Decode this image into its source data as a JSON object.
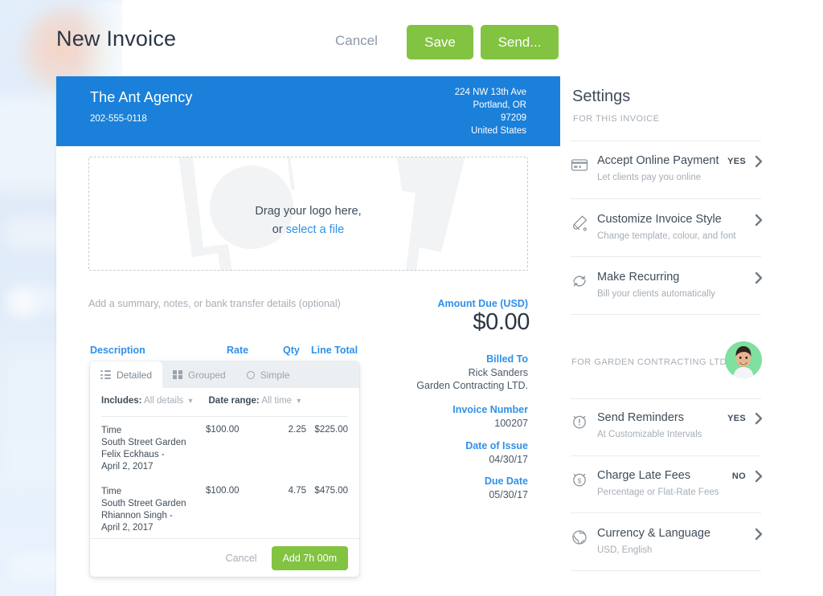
{
  "header": {
    "title": "New Invoice",
    "cancel_label": "Cancel",
    "save_label": "Save",
    "send_label": "Send...",
    "accent_green": "#82c341"
  },
  "invoice": {
    "accent_blue": "#1b80d9",
    "company_name": "The Ant Agency",
    "company_phone": "202-555-0118",
    "address_line1": "224 NW 13th Ave",
    "address_line2": "Portland, OR",
    "address_line3": "97209",
    "address_line4": "United States",
    "dropzone_line1": "Drag your logo here,",
    "dropzone_or": "or ",
    "dropzone_link": "select a file",
    "summary_hint": "Add a summary, notes, or bank transfer details (optional)",
    "amount_due_label": "Amount Due (USD)",
    "amount_due_value": "$0.00",
    "billed_to_label": "Billed To",
    "billed_to_name": "Rick Sanders",
    "billed_to_company": "Garden Contracting LTD.",
    "invoice_number_label": "Invoice Number",
    "invoice_number_value": "100207",
    "date_of_issue_label": "Date of Issue",
    "date_of_issue_value": "04/30/17",
    "due_date_label": "Due Date",
    "due_date_value": "05/30/17",
    "table_headers": {
      "description": "Description",
      "rate": "Rate",
      "qty": "Qty",
      "line_total": "Line Total"
    }
  },
  "time_popup": {
    "tabs": [
      {
        "label": "Detailed",
        "icon": "list-icon",
        "active": true
      },
      {
        "label": "Grouped",
        "icon": "grid-icon",
        "active": false
      },
      {
        "label": "Simple",
        "icon": "circle-icon",
        "active": false
      }
    ],
    "filters": [
      {
        "label": "Includes:",
        "value": "All details"
      },
      {
        "label": "Date range:",
        "value": "All time"
      }
    ],
    "lines": [
      {
        "description": "Time\nSouth Street Garden\nFelix Eckhaus -\nApril 2, 2017",
        "rate": "$100.00",
        "qty": "2.25",
        "total": "$225.00"
      },
      {
        "description": "Time\nSouth Street Garden\nRhiannon Singh -\nApril 2, 2017",
        "rate": "$100.00",
        "qty": "4.75",
        "total": "$475.00"
      }
    ],
    "cancel_label": "Cancel",
    "add_label": "Add 7h 00m"
  },
  "settings": {
    "title": "Settings",
    "subtitle": "FOR THIS INVOICE",
    "client_section_label": "FOR GARDEN CONTRACTING LTD.",
    "items_top": [
      {
        "icon": "credit-card-icon",
        "label": "Accept Online Payment",
        "description": "Let clients pay you online",
        "value": "YES"
      },
      {
        "icon": "paint-roller-icon",
        "label": "Customize Invoice Style",
        "description": "Change template, colour, and font",
        "value": ""
      },
      {
        "icon": "recurring-icon",
        "label": "Make Recurring",
        "description": "Bill your clients automatically",
        "value": ""
      }
    ],
    "items_bottom": [
      {
        "icon": "alarm-icon",
        "label": "Send Reminders",
        "description": "At Customizable Intervals",
        "value": "YES"
      },
      {
        "icon": "late-fee-icon",
        "label": "Charge Late Fees",
        "description": "Percentage or Flat-Rate Fees",
        "value": "NO"
      },
      {
        "icon": "globe-icon",
        "label": "Currency & Language",
        "description": "USD, English",
        "value": ""
      }
    ]
  }
}
